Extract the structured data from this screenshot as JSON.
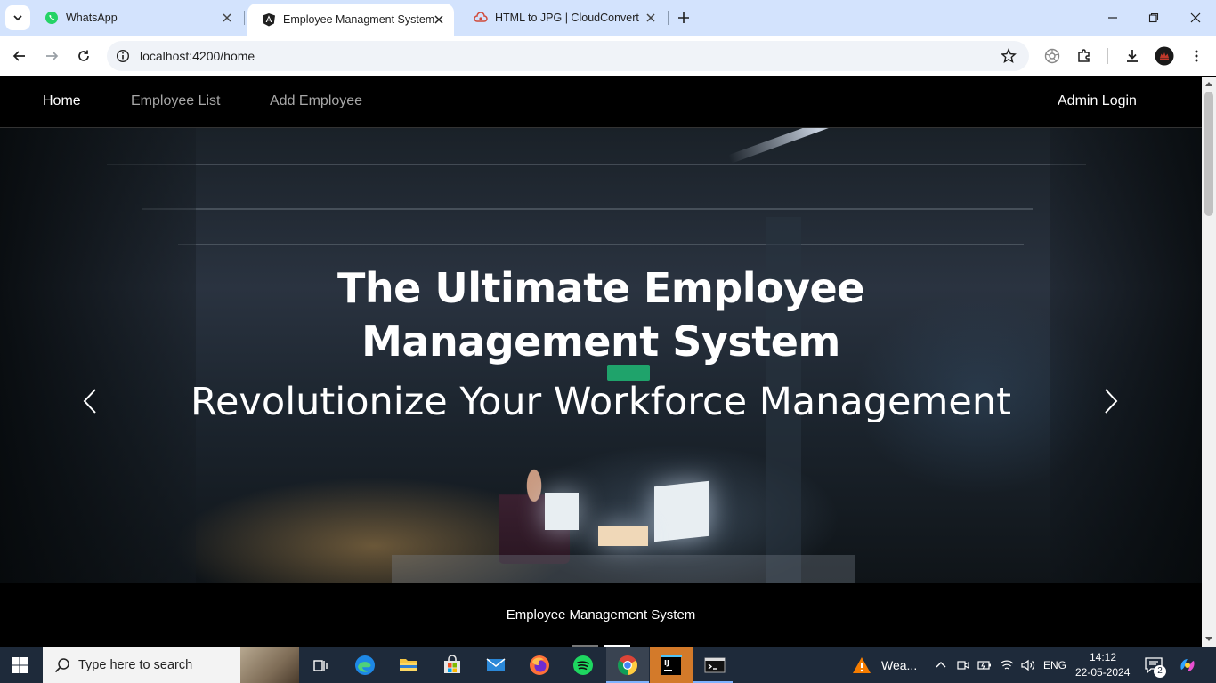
{
  "browser": {
    "tabs": [
      {
        "title": "WhatsApp",
        "icon": "whatsapp-icon"
      },
      {
        "title": "Employee Managment System",
        "icon": "angular-icon",
        "active": true
      },
      {
        "title": "HTML to JPG | CloudConvert",
        "icon": "cloudconvert-icon"
      }
    ],
    "url": "localhost:4200/home"
  },
  "nav": {
    "home": "Home",
    "employee_list": "Employee List",
    "add_employee": "Add Employee",
    "admin_login": "Admin Login"
  },
  "hero": {
    "title": "The Ultimate Employee Management System",
    "subtitle": "Revolutionize Your Workforce Management"
  },
  "caption": "Employee Management System",
  "taskbar": {
    "search_placeholder": "Type here to search",
    "weather": "Wea...",
    "language": "ENG",
    "time": "14:12",
    "date": "22-05-2024",
    "notification_count": "2"
  },
  "colors": {
    "tabstrip": "#d3e3fd",
    "navbar": "#000000",
    "taskbar": "#1e2a3a"
  }
}
